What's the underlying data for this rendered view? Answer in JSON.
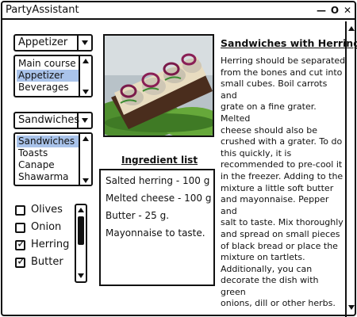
{
  "app": {
    "title": "PartyAssistant",
    "controls": {
      "minimize": "—",
      "maximize": "O",
      "close": "✕"
    }
  },
  "course_combo": {
    "selected": "Appetizer"
  },
  "course_list": {
    "items": [
      "Main course",
      "Appetizer",
      "Beverages"
    ],
    "selected_index": 1
  },
  "dish_combo": {
    "selected": "Sandwiches"
  },
  "dish_list": {
    "items": [
      "Sandwiches",
      "Toasts",
      "Canape",
      "Shawarma"
    ],
    "selected_index": 0
  },
  "ingredient_filters": [
    {
      "label": "Olives",
      "checked": false
    },
    {
      "label": "Onion",
      "checked": false
    },
    {
      "label": "Herring",
      "checked": true
    },
    {
      "label": "Butter",
      "checked": true
    }
  ],
  "ingredients": {
    "title": "Ingredient list",
    "lines": [
      "Salted herring - 100 g",
      "Melted cheese - 100 g",
      "Butter - 25 g.",
      "Mayonnaise to taste."
    ]
  },
  "recipe": {
    "title": "Sandwiches with Herring",
    "lines": [
      "Herring should be separated",
      "from the bones and cut into",
      "small cubes. Boil carrots and",
      "grate on a fine grater. Melted",
      "cheese should also be",
      "crushed with a grater. To do",
      "this quickly, it is",
      "recommended to pre-cool it",
      "in the freezer. Adding to the",
      "mixture a little soft butter",
      "and mayonnaise. Pepper and",
      "salt to taste. Mix thoroughly",
      "and spread on small pieces",
      "of black bread or place the",
      "mixture on tartlets.",
      "Additionally, you can",
      "decorate the dish with green",
      "onions, dill or other herbs."
    ]
  },
  "icons": {
    "dropdown": "chevron-down-icon",
    "scroll_up": "arrow-up-icon",
    "scroll_down": "arrow-down-icon",
    "check": "checkmark-icon"
  },
  "colors": {
    "selection": "#a9c3ea",
    "border": "#111111"
  }
}
